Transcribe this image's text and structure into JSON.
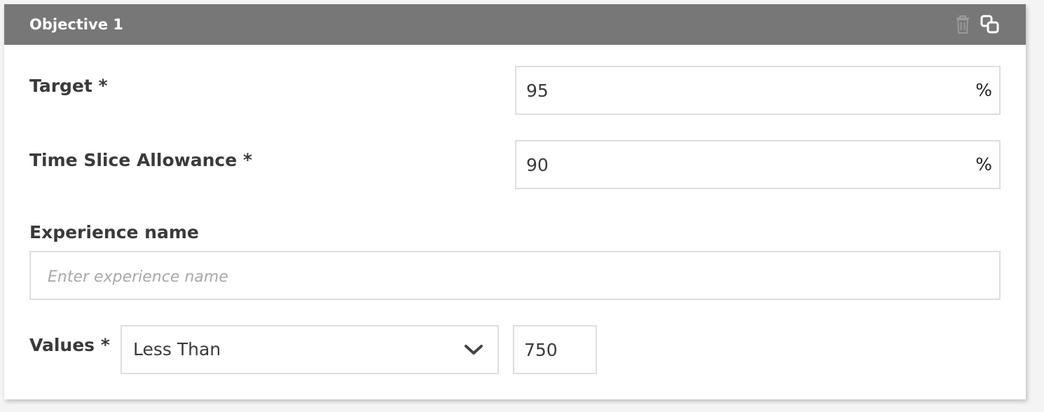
{
  "objective": {
    "title": "Objective 1",
    "icons": {
      "delete": "trash-icon",
      "duplicate": "copy-icon"
    },
    "target": {
      "label": "Target *",
      "value": "95",
      "unit": "%"
    },
    "time_slice_allowance": {
      "label": "Time Slice Allowance *",
      "value": "90",
      "unit": "%"
    },
    "experience_name": {
      "label": "Experience name",
      "value": "",
      "placeholder": "Enter experience name"
    },
    "values": {
      "label": "Values *",
      "operator": "Less Than",
      "threshold": "750"
    }
  },
  "colors": {
    "header_bg": "#777777",
    "border": "#dedede",
    "text": "#3a3a3a"
  }
}
